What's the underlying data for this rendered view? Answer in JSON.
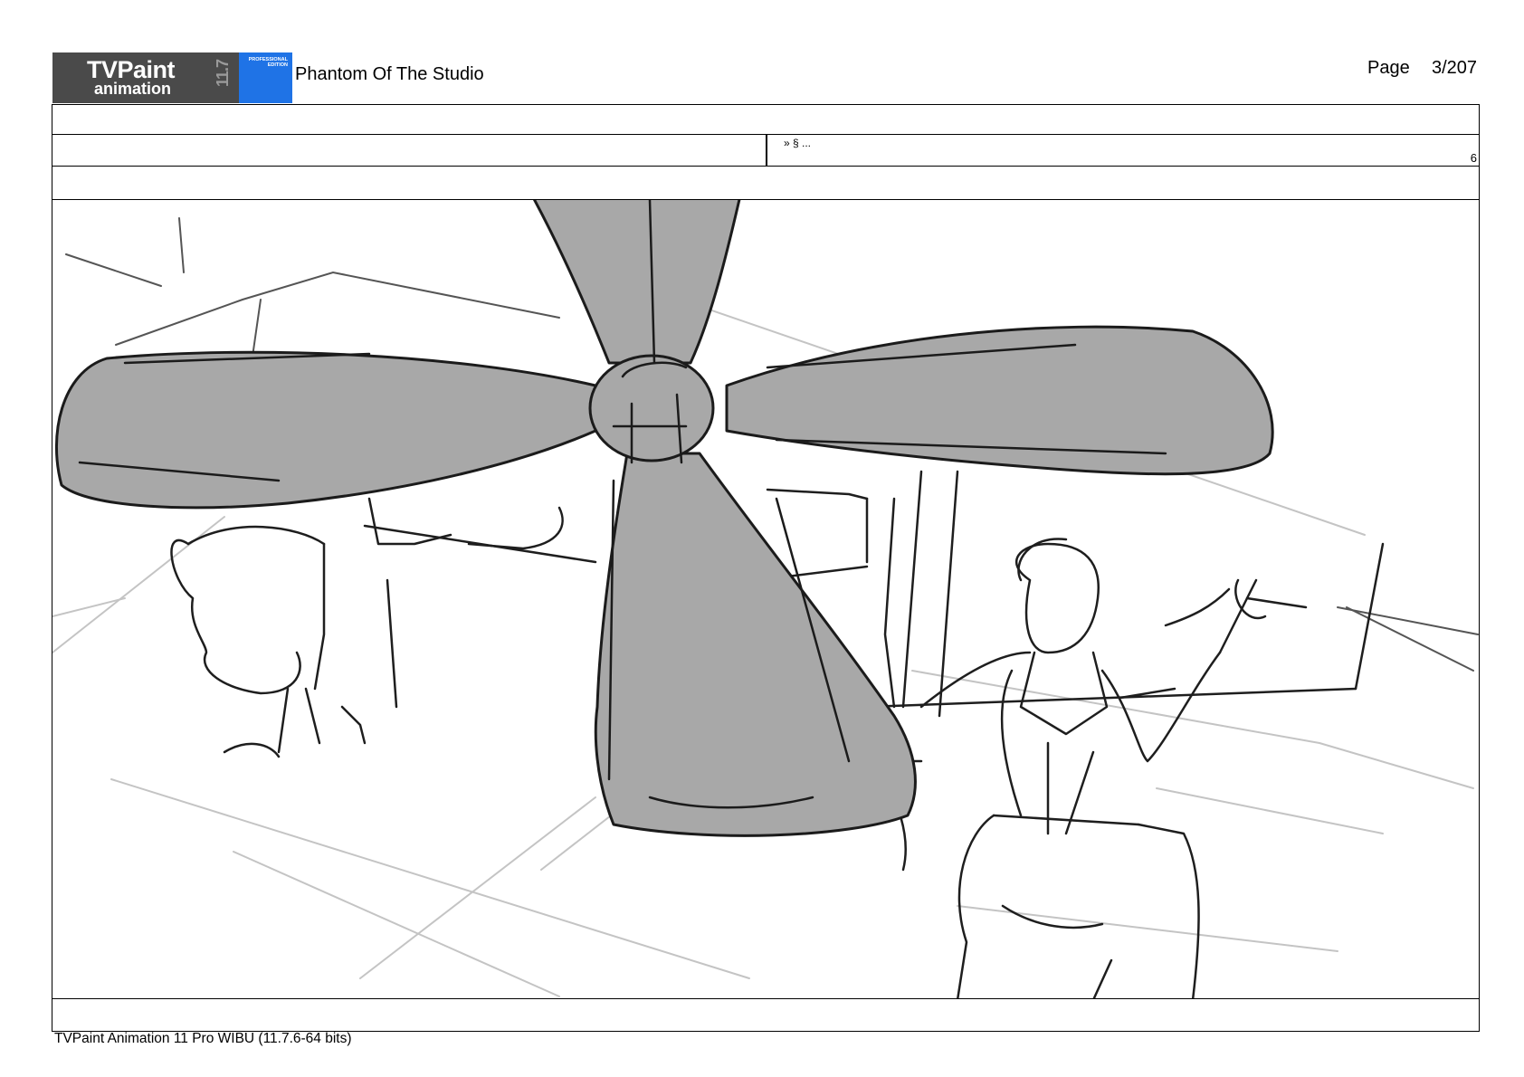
{
  "header": {
    "logo": {
      "brand": "TVPaint",
      "product": "animation",
      "version": "11.7",
      "edition": "PROFESSIONAL EDITION"
    },
    "project_title": "Phantom Of The Studio",
    "page_label": "Page",
    "page_number": "3/207"
  },
  "rows": {
    "note": "» § ...",
    "count": "6"
  },
  "panel": {
    "icon": "storyboard-sketch-ceiling-fan-over-artist-desk"
  },
  "footer": {
    "software": "TVPaint Animation 11 Pro WIBU (11.7.6-64 bits)"
  }
}
